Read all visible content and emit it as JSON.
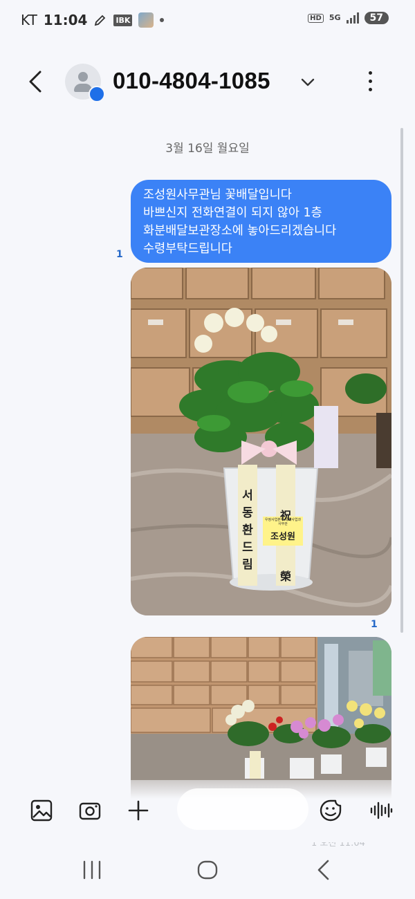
{
  "status_bar": {
    "carrier": "KT",
    "time": "11:04",
    "ibk_label": "IBK",
    "hd_label": "HD",
    "network_label": "5G",
    "battery": "57"
  },
  "header": {
    "contact_name": "010-4804-1085"
  },
  "conversation": {
    "date_label": "3월 16일 월요일",
    "message": {
      "lines": [
        "조성원사무관님 꽃배달입니다",
        "바쁘신지 전화연결이 되지 않아 1층",
        "화분배달보관장소에 놓아드리겠습니다",
        "수령부탁드립니다"
      ],
      "unread_count": "1"
    },
    "image1": {
      "unread_count": "1",
      "ribbon_left": "서동환 드림",
      "ribbon_right": "祝 榮轉",
      "card_text": "조성원",
      "card_small": "우정사업본부 국제사업과 사무관"
    },
    "partial_time": "1 오전 11:04"
  },
  "composer": {
    "icons": [
      "gallery-icon",
      "camera-icon",
      "plus-icon",
      "emoji-icon",
      "voice-icon"
    ]
  },
  "nav_bar": {
    "icons": [
      "recent-apps-icon",
      "home-icon",
      "back-icon"
    ]
  },
  "colors": {
    "accent": "#3b82f6",
    "background": "#f6f7fb",
    "read_indicator": "#2568c8"
  }
}
